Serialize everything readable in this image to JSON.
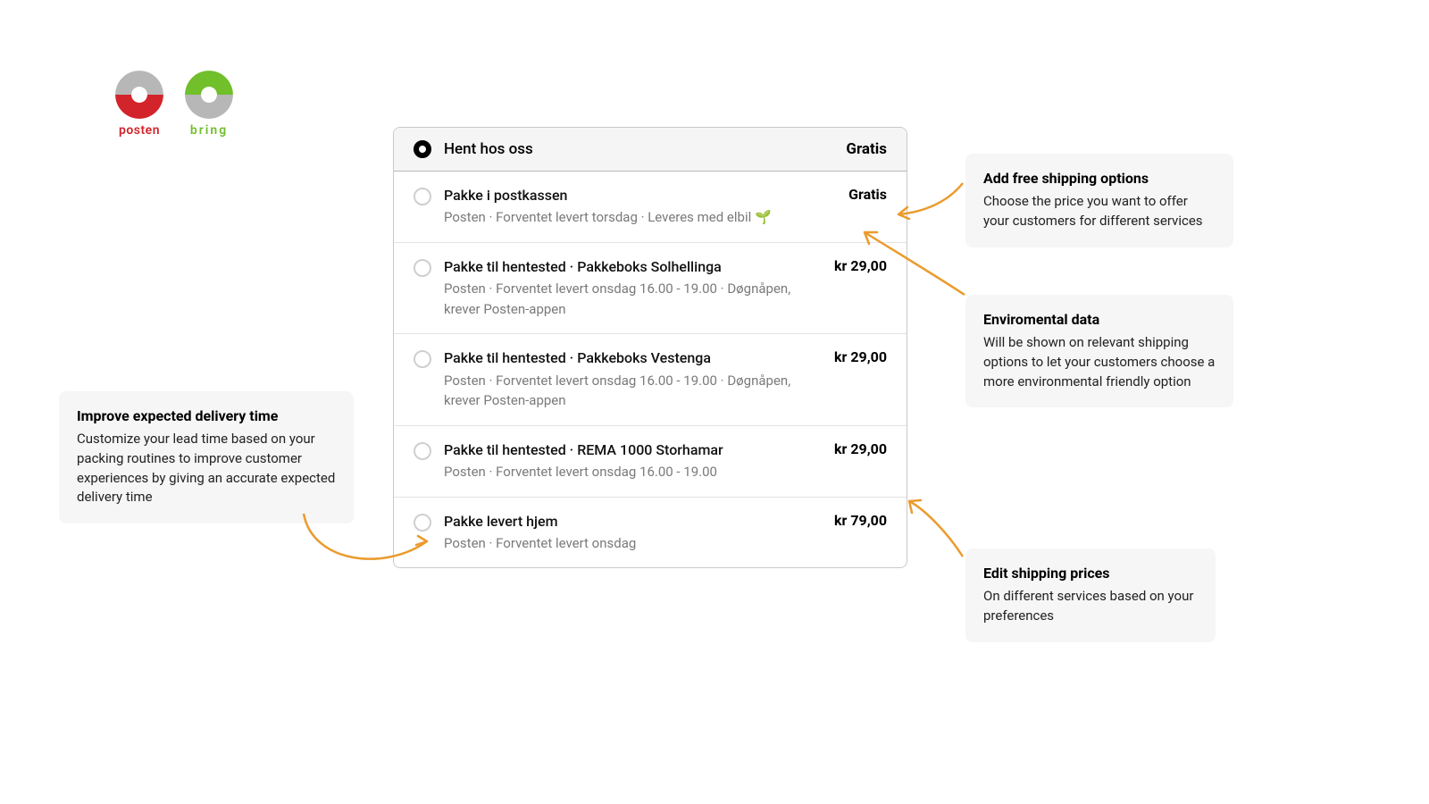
{
  "logos": {
    "posten_label": "posten",
    "bring_label": "bring"
  },
  "card": {
    "header": {
      "title": "Hent hos oss",
      "price": "Gratis"
    },
    "options": [
      {
        "title": "Pakke i postkassen",
        "sub": "Posten · Forventet levert torsdag · Leveres med elbil",
        "price": "Gratis",
        "eco": true
      },
      {
        "title": "Pakke til hentested · Pakkeboks Solhellinga",
        "sub": "Posten · Forventet levert onsdag 16.00 - 19.00 · Døgnåpen, krever Posten-appen",
        "price": "kr 29,00",
        "eco": false
      },
      {
        "title": "Pakke til hentested · Pakkeboks Vestenga",
        "sub": "Posten · Forventet levert onsdag 16.00 - 19.00 · Døgnåpen, krever Posten-appen",
        "price": "kr 29,00",
        "eco": false
      },
      {
        "title": "Pakke til hentested · REMA 1000 Storhamar",
        "sub": "Posten · Forventet levert onsdag 16.00 - 19.00",
        "price": "kr 29,00",
        "eco": false
      },
      {
        "title": "Pakke levert hjem",
        "sub": "Posten · Forventet levert onsdag",
        "price": "kr 79,00",
        "eco": false
      }
    ]
  },
  "callouts": {
    "left": {
      "title": "Improve expected delivery time",
      "body": "Customize your lead time based on your packing routines to improve customer experiences by giving an accurate expected delivery time"
    },
    "r1": {
      "title": "Add free shipping options",
      "body": "Choose the price you want to offer your customers for different services"
    },
    "r2": {
      "title": "Enviromental data",
      "body": "Will be shown on relevant shipping options to let your customers choose a more environmental friendly option"
    },
    "r3": {
      "title": "Edit shipping prices",
      "body": "On different services based on your preferences"
    }
  },
  "colors": {
    "arrow": "#eb9b2d",
    "posten_red": "#d2242a",
    "bring_green": "#70bf2b",
    "logo_grey": "#b7b7b7"
  }
}
